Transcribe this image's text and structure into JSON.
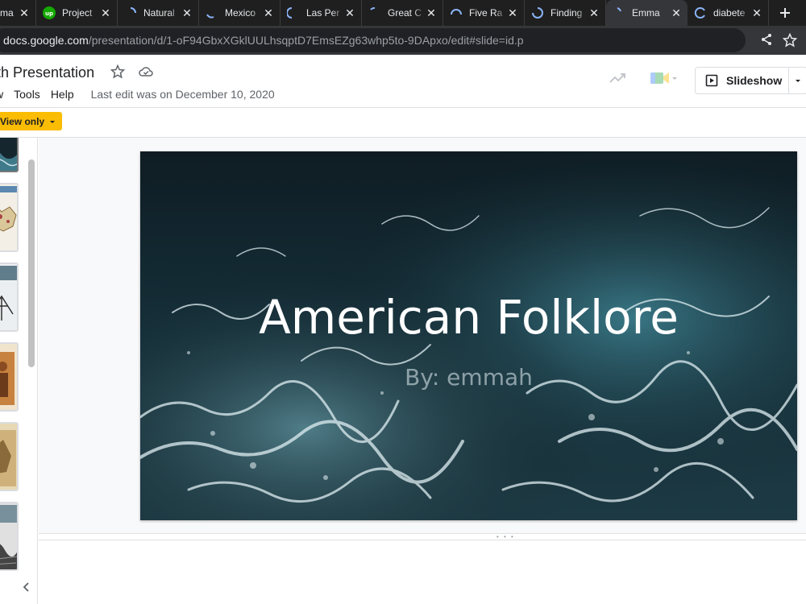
{
  "browser": {
    "tabs": [
      {
        "title": "ma",
        "favicon": "page-icon",
        "active": false
      },
      {
        "title": "Project",
        "favicon": "upwork-icon",
        "active": false
      },
      {
        "title": "Natural",
        "favicon": "loading-spinner-icon",
        "active": false
      },
      {
        "title": "Mexico",
        "favicon": "loading-spinner-icon",
        "active": false
      },
      {
        "title": "Las Per",
        "favicon": "loading-spinner-icon",
        "active": false
      },
      {
        "title": "Great C",
        "favicon": "loading-spinner-icon",
        "active": false
      },
      {
        "title": "Five Ra",
        "favicon": "loading-spinner-icon",
        "active": false
      },
      {
        "title": "Finding",
        "favicon": "loading-spinner-icon",
        "active": false
      },
      {
        "title": "Emma",
        "favicon": "loading-spinner-icon",
        "active": true
      },
      {
        "title": "diabete",
        "favicon": "loading-spinner-icon",
        "active": false
      }
    ],
    "url_host": "docs.google.com",
    "url_path": "/presentation/d/1-oF94GbxXGklUULhsqptD7EmsEZg63whp5to-9DApxo/edit#slide=id.p",
    "accent_color": "#8ab4f8"
  },
  "docs": {
    "title": "th Presentation",
    "menu": [
      "w",
      "Tools",
      "Help"
    ],
    "last_edit": "Last edit was on December 10, 2020",
    "slideshow_label": "Slideshow",
    "view_only_label": "View only",
    "view_only_color": "#fbbc04"
  },
  "slide": {
    "title": "American Folklore",
    "subtitle": "By: emmah"
  },
  "filmstrip": {
    "thumbnail_count": 6,
    "selected_index": 0
  }
}
